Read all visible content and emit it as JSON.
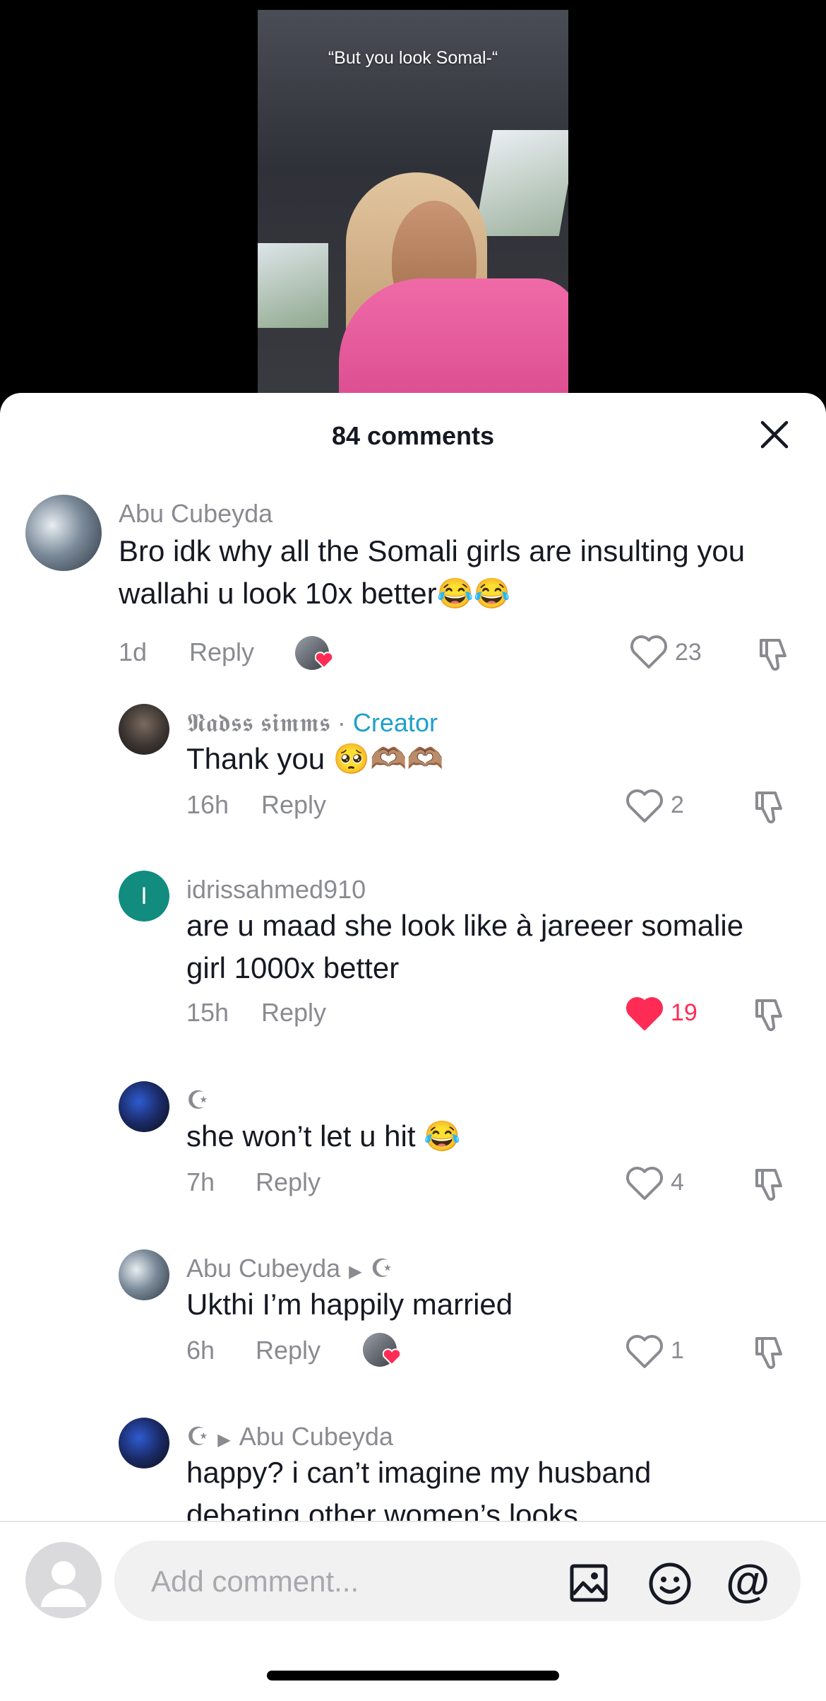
{
  "video": {
    "caption": "“But you look Somal-“"
  },
  "sheet": {
    "title": "84 comments"
  },
  "comments": [
    {
      "user": "Abu Cubeyda",
      "text": "Bro idk why all the Somali girls are insulting you wallahi u look 10x better😂😂",
      "time": "1d",
      "reply": "Reply",
      "likes": "23",
      "liked": false,
      "creator_liked": true
    },
    {
      "user": "𝕹𝖆𝖉𝖘𝖘 𝖘𝖎𝖒𝖒𝖘",
      "sep": " · ",
      "badge": "Creator",
      "text": "Thank you 🥺🫶🏽🫶🏽",
      "time": "16h",
      "reply": "Reply",
      "likes": "2",
      "liked": false
    },
    {
      "user": "idrissahmed910",
      "avatar_letter": "I",
      "text": "are u maad she look like à jareeer somalie girl 1000x better",
      "time": "15h",
      "reply": "Reply",
      "likes": "19",
      "liked": true
    },
    {
      "user": "☪︎",
      "text": "she won’t let u hit 😂",
      "time": "7h",
      "reply": "Reply",
      "likes": "4",
      "liked": false
    },
    {
      "user": "Abu Cubeyda",
      "reply_to": "☪︎",
      "text": "Ukthi I’m happily married",
      "time": "6h",
      "reply": "Reply",
      "likes": "1",
      "liked": false,
      "creator_liked": true
    },
    {
      "user": "☪︎",
      "reply_to": "Abu Cubeyda",
      "text": "happy? i can’t imagine my husband debating other women’s looks"
    }
  ],
  "input": {
    "placeholder": "Add comment..."
  },
  "icons": [
    "close-icon",
    "heart-icon",
    "dislike-icon",
    "image-icon",
    "emoji-icon",
    "mention-icon"
  ],
  "colors": {
    "accent_creator": "#1ea0c8",
    "liked_heart": "#fe2c55",
    "avatar_green": "#128c7e"
  }
}
